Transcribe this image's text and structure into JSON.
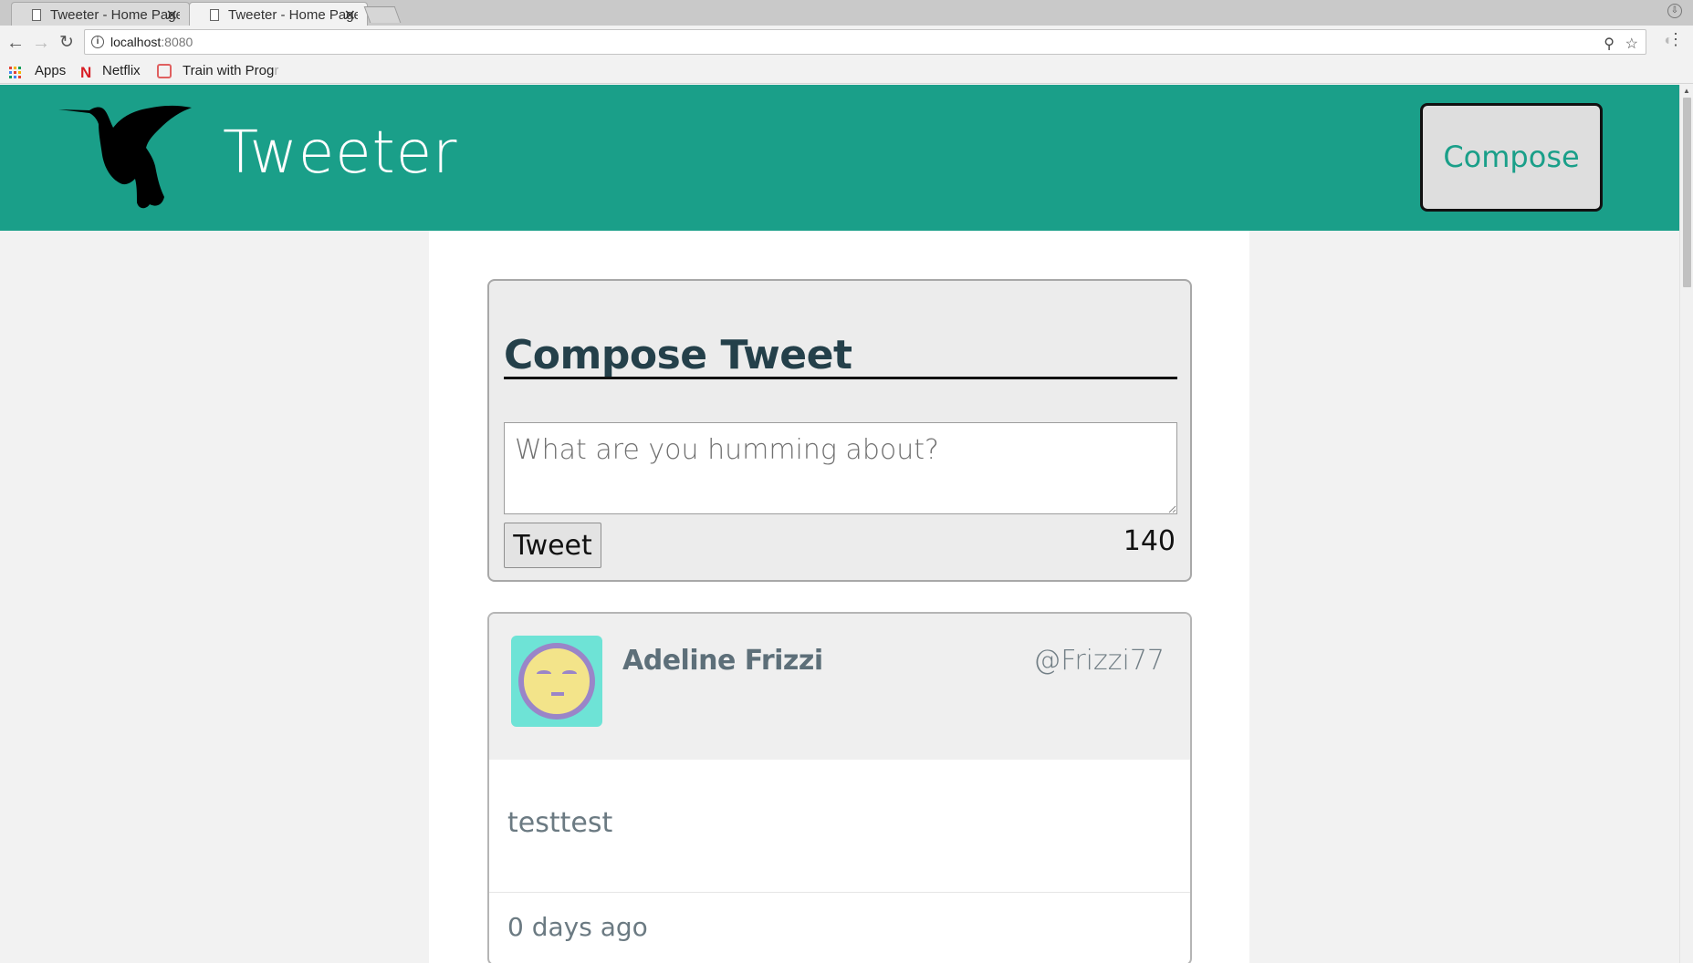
{
  "browser": {
    "tabs": [
      {
        "title": "Tweeter - Home Page",
        "active": false
      },
      {
        "title": "Tweeter - Home Page",
        "active": true
      }
    ],
    "url_host": "localhost",
    "url_port": ":8080",
    "bookmarks": {
      "apps": "Apps",
      "netflix": "Netflix",
      "netflix_logo": "N",
      "train_visible": "Train with Prog",
      "train_faded": "r"
    },
    "icons": [
      "back-icon",
      "forward-icon",
      "reload-icon",
      "info-icon",
      "zoom-icon",
      "star-icon",
      "menu-icon"
    ]
  },
  "header": {
    "title": "Tweeter",
    "compose_label": "Compose"
  },
  "compose": {
    "heading": "Compose Tweet",
    "placeholder": "What are you humming about?",
    "tweet_button": "Tweet",
    "counter": "140"
  },
  "tweet": {
    "name": "Adeline Frizzi",
    "handle": "@Frizzi77",
    "text": "testtest",
    "time": "0 days ago"
  },
  "colors": {
    "header_bg": "#1a9f89",
    "compose_text": "#1a9f89",
    "heading": "#24404a",
    "avatar_bg": "#6ee3d6"
  }
}
